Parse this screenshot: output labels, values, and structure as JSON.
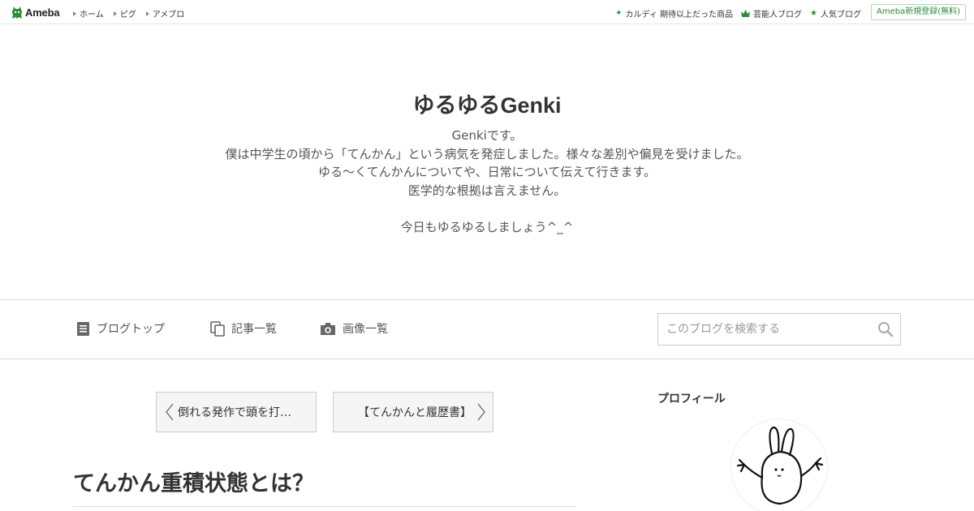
{
  "topbar": {
    "logo_text": "Ameba",
    "nav_left": [
      {
        "label": "ホーム"
      },
      {
        "label": "ピグ"
      },
      {
        "label": "アメブロ"
      }
    ],
    "nav_right": [
      {
        "label": "カルディ 期待以上だった商品",
        "icon": "sparkle-icon"
      },
      {
        "label": "芸能人ブログ",
        "icon": "crown-icon"
      },
      {
        "label": "人気ブログ",
        "icon": "star-icon"
      }
    ],
    "register_label": "Ameba新規登録(無料)"
  },
  "header": {
    "title": "ゆるゆるGenki",
    "description_lines": [
      "Genkiです。",
      "僕は中学生の頃から「てんかん」という病気を発症しました。様々な差別や偏見を受けました。",
      "ゆる〜くてんかんについてや、日常について伝えて行きます。",
      "医学的な根拠は言えません。",
      "",
      "今日もゆるゆるしましょう^_^"
    ]
  },
  "nav": {
    "items": [
      {
        "label": "ブログトップ",
        "icon": "document-icon"
      },
      {
        "label": "記事一覧",
        "icon": "copy-icon"
      },
      {
        "label": "画像一覧",
        "icon": "camera-icon"
      }
    ],
    "search_placeholder": "このブログを検索する"
  },
  "pager": {
    "prev_label": "倒れる発作で頭を打…",
    "next_label": "【てんかんと履歴書】"
  },
  "article": {
    "title": "てんかん重積状態とは？"
  },
  "sidebar": {
    "profile_heading": "プロフィール"
  },
  "colors": {
    "accent_green": "#2d8c3c",
    "text": "#333333",
    "border": "#dddddd"
  }
}
